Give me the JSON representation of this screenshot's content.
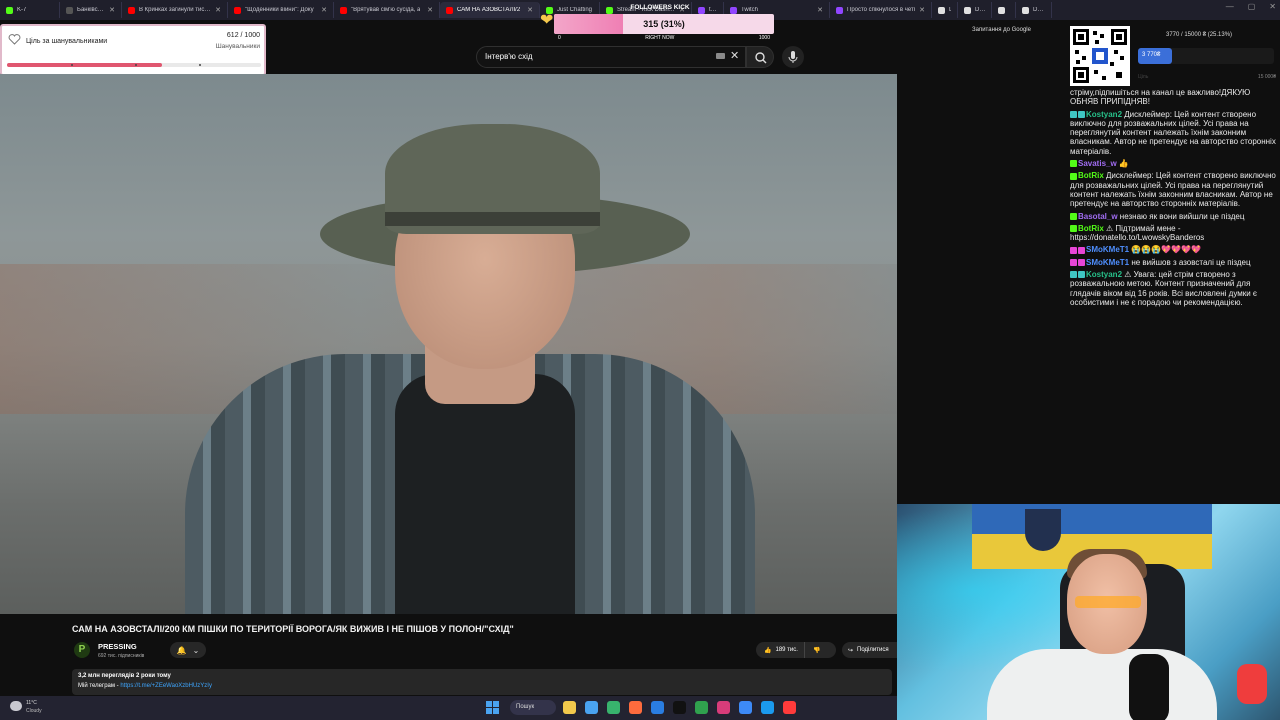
{
  "browser": {
    "tabs": [
      {
        "label": "K-7",
        "fav": "#53fc18",
        "width": 60,
        "active": false
      },
      {
        "label": "Банківська категорія",
        "fav": "#555",
        "width": 62,
        "active": false
      },
      {
        "label": "В Кринках загинули тисячі",
        "fav": "#ff0000",
        "width": 106,
        "active": false
      },
      {
        "label": "\"Щоденники війни\": Доку",
        "fav": "#ff0000",
        "width": 106,
        "active": false
      },
      {
        "label": "\"Врятував сім'ю сусіда, а",
        "fav": "#ff0000",
        "width": 106,
        "active": false
      },
      {
        "label": "САМ НА АЗОВСТАЛІ/2",
        "fav": "#ff0000",
        "width": 100,
        "active": true
      },
      {
        "label": "Just Chatting",
        "fav": "#53fc18",
        "width": 60,
        "active": false
      },
      {
        "label": "Stream - Kick Dashboard",
        "fav": "#53fc18",
        "width": 92,
        "active": false
      },
      {
        "label": "twitch",
        "fav": "#9146ff",
        "width": 32,
        "active": false
      },
      {
        "label": "Twitch",
        "fav": "#9146ff",
        "width": 106,
        "active": false
      },
      {
        "label": "Просто спікнулося в четі",
        "fav": "#9146ff",
        "width": 102,
        "active": false
      },
      {
        "label": "Donate",
        "fav": "#e0e0e0",
        "width": 26,
        "active": false
      },
      {
        "label": "Donatello",
        "fav": "#e0e0e0",
        "width": 34,
        "active": false
      },
      {
        "label": "Firma",
        "fav": "#e0e0e0",
        "width": 24,
        "active": false
      },
      {
        "label": "DeepState",
        "fav": "#e0e0e0",
        "width": 36,
        "active": false
      }
    ],
    "translate_label": "Запитання до Google"
  },
  "followers_kick": {
    "title": "FOLLOWERS KICK",
    "current_text": "315 (31%)",
    "progress": 0.315,
    "scale_min": "0",
    "scale_mid": "RIGHT NOW",
    "scale_max": "1000"
  },
  "goal_widget": {
    "title": "Ціль за шанувальниками",
    "count": "612 / 1000",
    "subtitle": "Шанувальники",
    "progress": 0.612
  },
  "youtube": {
    "search_query": "Інтерв'ю схід",
    "video_title": "САМ НА АЗОВСТАЛІ/200 КМ ПІШКИ ПО ТЕРИТОРІЇ ВОРОГА/ЯК ВИЖИВ І НЕ ПІШОВ У ПОЛОН/\"СХІД\"",
    "channel": {
      "logo_letter": "P",
      "name": "PRESSING",
      "subs": "692 тис. підписників"
    },
    "likes": "189 тис.",
    "share_label": "Поділитися",
    "views_meta": "3,2 млн переглядів  2 роки тому",
    "desc_prefix": "Мій телеграм - ",
    "desc_link": "https://t.me/+ZEeWaoXzbHUzYzIy"
  },
  "donation": {
    "progress_text": "3770 / 15000 ₴ (25.13%)",
    "amount_label": "3 770₴",
    "progress": 0.2513,
    "min_label": "Ціль",
    "max_label": "15 000₴"
  },
  "chat": [
    {
      "badges": [],
      "user": "",
      "user_class": "",
      "text": "стріму,підпишіться на канал це важливо!ДЯКУЮ ОБНЯВ ПРИПІДНЯВ!"
    },
    {
      "badges": [
        "cyan",
        "cyan"
      ],
      "user": "Kostyan2",
      "user_class": "teal",
      "text": "Дисклеймер: Цей контент створено виключно для розважальних цілей. Усі права на переглянутий контент належать їхнім законним власникам. Автор не претендує на авторство сторонніх матеріалів."
    },
    {
      "badges": [
        "green"
      ],
      "user": "Savatis_w",
      "user_class": "violet",
      "text": "👍"
    },
    {
      "badges": [
        "green"
      ],
      "user": "BotRix",
      "user_class": "green",
      "text": "Дисклеймер: Цей контент створено виключно для розважальних цілей. Усі права на переглянутий контент належать їхнім законним власникам. Автор не претендує на авторство сторонніх матеріалів."
    },
    {
      "badges": [
        "green"
      ],
      "user": "Basotal_w",
      "user_class": "violet",
      "text": "незнаю як вони вийшли це піздец"
    },
    {
      "badges": [
        "green"
      ],
      "user": "BotRix",
      "user_class": "green",
      "text": "⚠ Підтримай мене - https://donatello.to/LwowskyBanderos"
    },
    {
      "badges": [
        "pink",
        "pink"
      ],
      "user": "SMoKMeT1",
      "user_class": "blue",
      "text": "😭😭😭💖💖💖💖"
    },
    {
      "badges": [
        "pink",
        "pink"
      ],
      "user": "SMoKMeT1",
      "user_class": "blue",
      "text": "не вийшов з азовсталі це піздец"
    },
    {
      "badges": [
        "cyan",
        "cyan"
      ],
      "user": "Kostyan2",
      "user_class": "teal",
      "text": "⚠ Увага: цей стрім створено з розважальною метою. Контент призначений для глядачів віком від 16 років. Всі висловлені думки є особистими і не є порадою чи рекомендацією."
    }
  ],
  "taskbar": {
    "temp": "11°C",
    "weather": "Cloudy",
    "search_label": "Пошук",
    "apps": [
      "#f2c94c",
      "#4aa3f0",
      "#38b36d",
      "#ff6b3d",
      "#2a7de1",
      "#111111",
      "#30a14e",
      "#d83c7a",
      "#3d8af7",
      "#1b9aee",
      "#ff3b3b"
    ]
  },
  "colors": {
    "accent_kick": "#53fc18",
    "goal_fill": "#e0566f",
    "donation_fill": "#3b6fd9"
  }
}
